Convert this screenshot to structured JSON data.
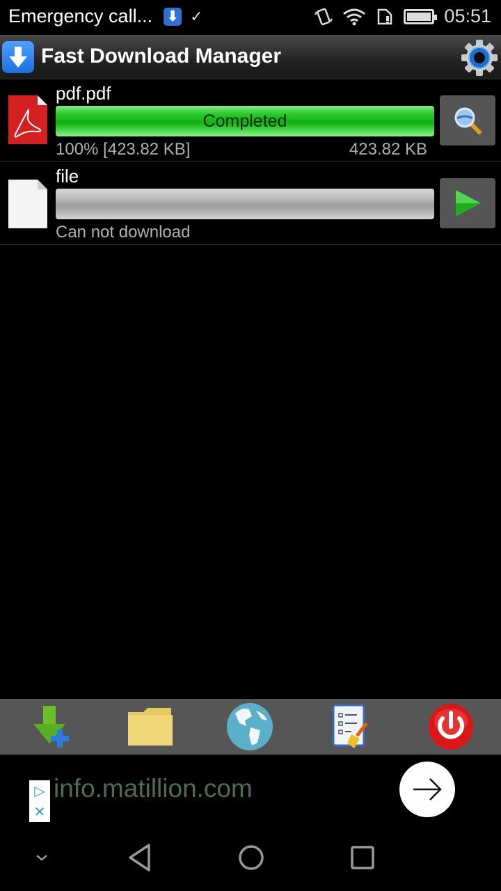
{
  "status_bar": {
    "carrier_text": "Emergency call...",
    "download_notification": "⬇",
    "check_notification": "✓",
    "time": "05:51"
  },
  "app_bar": {
    "title": "Fast Download Manager"
  },
  "downloads": [
    {
      "name": "pdf.pdf",
      "file_type": "pdf",
      "status": "Completed",
      "progress_percent": 100,
      "progress_text": "100% [423.82 KB]",
      "size_text": "423.82 KB",
      "action": "search-icon",
      "bar_color": "#2ecc2e"
    },
    {
      "name": "file",
      "file_type": "generic",
      "status": "",
      "progress_percent": 0,
      "progress_text": "Can not download",
      "size_text": "",
      "action": "play-icon",
      "bar_color": "#aaaaaa"
    }
  ],
  "toolbar": {
    "items": [
      {
        "name": "add-download",
        "icon": "download-plus-icon"
      },
      {
        "name": "folder",
        "icon": "folder-icon"
      },
      {
        "name": "browser",
        "icon": "globe-icon"
      },
      {
        "name": "clear-list",
        "icon": "clear-list-icon"
      },
      {
        "name": "exit",
        "icon": "power-icon"
      }
    ]
  },
  "ad": {
    "text": "info.matillion.com",
    "adchoices": "▷",
    "close": "✕"
  },
  "nav_bar": {
    "items": [
      "collapse",
      "back",
      "home",
      "recents"
    ]
  }
}
